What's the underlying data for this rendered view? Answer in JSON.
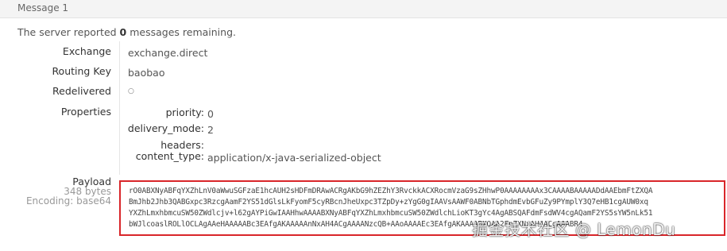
{
  "header": {
    "title": "Message 1"
  },
  "status": {
    "prefix": "The server reported ",
    "count": "0",
    "suffix": " messages remaining."
  },
  "fields": {
    "exchange": {
      "label": "Exchange",
      "value": "exchange.direct"
    },
    "routing_key": {
      "label": "Routing Key",
      "value": "baobao"
    },
    "redelivered": {
      "label": "Redelivered",
      "value": "○"
    },
    "properties": {
      "label": "Properties"
    }
  },
  "properties": [
    {
      "key": "priority:",
      "value": "0"
    },
    {
      "key": "delivery_mode:",
      "value": "2"
    },
    {
      "key": "headers:",
      "value": ""
    },
    {
      "key": "content_type:",
      "value": "application/x-java-serialized-object"
    }
  ],
  "payload": {
    "label": "Payload",
    "size": "348 bytes",
    "encoding": "Encoding: base64",
    "lines": [
      "rO0ABXNyABFqYXZhLnV0aWwuSGFzaE1hcAUH2sHDFmDRAwACRgAKbG9hZEZhY3RvckkACXRocmVzaG9sZHhwP0AAAAAAAAx3CAAAABAAAAADdAAEbmFtZXQA",
      "BmJhb2Jhb3QABGxpc3RzcgAamF2YS51dGlsLkFyomF5cyRBcnJheUxpc3TZpDy+zYgG0gIAAVsAAWF0ABNbTGphdmEvbGFuZy9PYmplY3Q7eHB1cgAUW0xq",
      "YXZhLmxhbmcuSW50ZWdlcjv+l62gAYPiGwIAAHhwAAAABXNyABFqYXZhLmxhbmcuSW50ZWdlchLioKT3gYc4AgABSQAFdmFsdWV4cgAQamF2YS5sYW5nLk51",
      "bWJlcoaslROLlOCLAgAAeHAAAAABc3EAfgAKAAAAAnNxAH4ACgAAAANzcQB+AAoAAAAEc3EAfgAKAAAABXQAA2FnZXNxAH4ACgAAABR4"
    ]
  },
  "watermark": {
    "text": "掘金技术社区 @ LemonDu"
  },
  "colors": {
    "payload_border": "#d9262a",
    "header_bg": "#f4f4f4"
  }
}
